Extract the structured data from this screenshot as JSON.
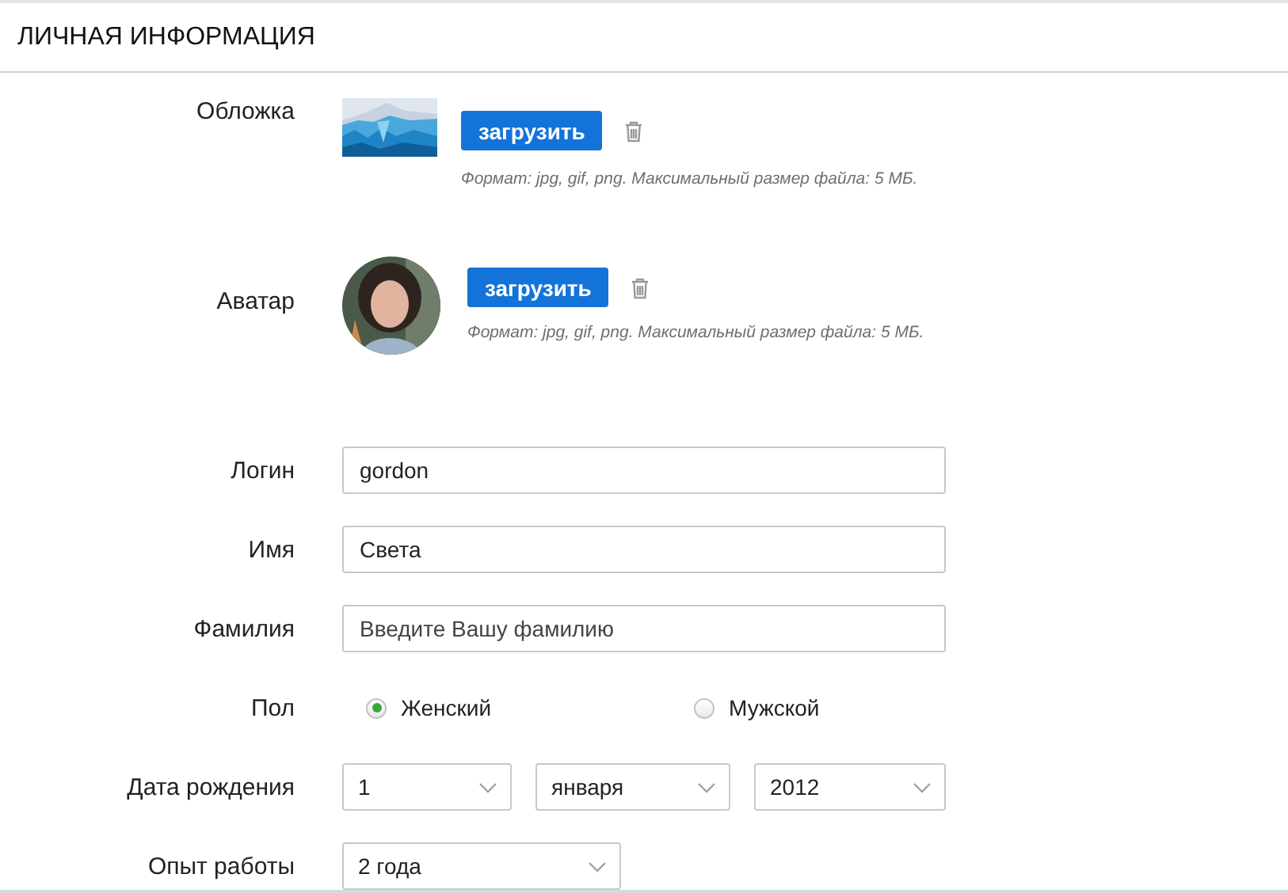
{
  "section_title": "ЛИЧНАЯ ИНФОРМАЦИЯ",
  "uploads": [
    {
      "label": "Обложка",
      "kind": "cover",
      "button": "загрузить",
      "hint": "Формат: jpg, gif, png. Максимальный размер файла: 5 МБ."
    },
    {
      "label": "Аватар",
      "kind": "avatar",
      "button": "загрузить",
      "hint": "Формат: jpg, gif, png. Максимальный размер файла: 5 МБ."
    }
  ],
  "fields": [
    {
      "label": "Логин",
      "value": "gordon"
    },
    {
      "label": "Имя",
      "value": "Света"
    },
    {
      "label": "Фамилия",
      "placeholder": "Введите Вашу фамилию"
    }
  ],
  "gender": {
    "label": "Пол",
    "options": [
      {
        "label": "Женский",
        "selected": true
      },
      {
        "label": "Мужской",
        "selected": false
      }
    ]
  },
  "birth_date": {
    "label": "Дата рождения",
    "day": "1",
    "month": "января",
    "year": "2012"
  },
  "experience": {
    "label": "Опыт работы",
    "value": "2 года"
  }
}
